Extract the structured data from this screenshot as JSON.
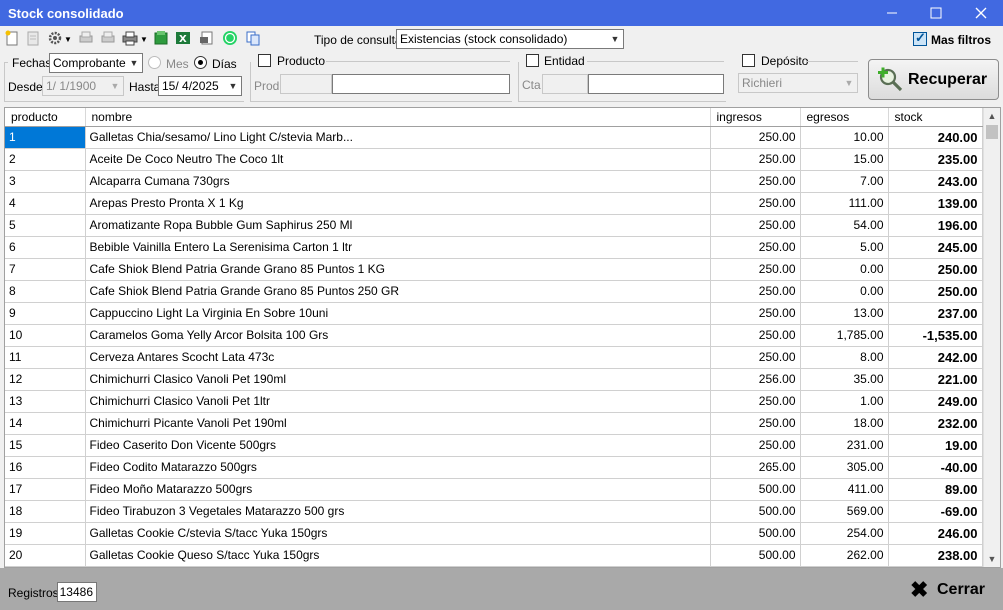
{
  "window": {
    "title": "Stock consolidado"
  },
  "toolbar": {
    "tipo_label": "Tipo de consulta",
    "tipo_value": "Existencias (stock consolidado)",
    "mas_filtros_label": "Mas filtros"
  },
  "filters": {
    "fechas_label": "Fechas",
    "fechas_value": "Comprobante",
    "mes_label": "Mes",
    "dias_label": "Días",
    "desde_label": "Desde",
    "desde_value": " 1/  1/1900",
    "hasta_label": "Hasta",
    "hasta_value": "15/  4/2025",
    "producto_label": "Producto",
    "prod_label": "Prod.",
    "entidad_label": "Entidad",
    "cta_label": "Cta",
    "deposito_label": "Depósito",
    "deposito_value": "Richieri",
    "recuperar_label": "Recuperar"
  },
  "grid": {
    "columns": [
      "producto",
      "nombre",
      "ingresos",
      "egresos",
      "stock"
    ],
    "rows": [
      [
        "1",
        "Galletas Chia/sesamo/ Lino Light C/stevia Marb...",
        "250.00",
        "10.00",
        "240.00"
      ],
      [
        "2",
        "Aceite De Coco Neutro The Coco 1lt",
        "250.00",
        "15.00",
        "235.00"
      ],
      [
        "3",
        "Alcaparra Cumana 730grs",
        "250.00",
        "7.00",
        "243.00"
      ],
      [
        "4",
        "Arepas Presto Pronta X 1 Kg",
        "250.00",
        "111.00",
        "139.00"
      ],
      [
        "5",
        "Aromatizante Ropa Bubble Gum Saphirus 250 Ml",
        "250.00",
        "54.00",
        "196.00"
      ],
      [
        "6",
        "Bebible Vainilla Entero La Serenisima Carton 1 ltr",
        "250.00",
        "5.00",
        "245.00"
      ],
      [
        "7",
        "Cafe Shiok Blend Patria Grande Grano 85 Puntos 1 KG",
        "250.00",
        "0.00",
        "250.00"
      ],
      [
        "8",
        "Cafe Shiok Blend Patria Grande Grano 85 Puntos 250 GR",
        "250.00",
        "0.00",
        "250.00"
      ],
      [
        "9",
        "Cappuccino Light La Virginia En Sobre 10uni",
        "250.00",
        "13.00",
        "237.00"
      ],
      [
        "10",
        "Caramelos Goma Yelly Arcor Bolsita 100 Grs",
        "250.00",
        "1,785.00",
        "-1,535.00"
      ],
      [
        "11",
        "Cerveza Antares Scocht Lata 473c",
        "250.00",
        "8.00",
        "242.00"
      ],
      [
        "12",
        "Chimichurri Clasico Vanoli Pet 190ml",
        "256.00",
        "35.00",
        "221.00"
      ],
      [
        "13",
        "Chimichurri Clasico Vanoli Pet 1ltr",
        "250.00",
        "1.00",
        "249.00"
      ],
      [
        "14",
        "Chimichurri Picante Vanoli Pet 190ml",
        "250.00",
        "18.00",
        "232.00"
      ],
      [
        "15",
        "Fideo Caserito Don Vicente 500grs",
        "250.00",
        "231.00",
        "19.00"
      ],
      [
        "16",
        "Fideo Codito Matarazzo 500grs",
        "265.00",
        "305.00",
        "-40.00"
      ],
      [
        "17",
        "Fideo Moño Matarazzo 500grs",
        "500.00",
        "411.00",
        "89.00"
      ],
      [
        "18",
        "Fideo Tirabuzon 3 Vegetales Matarazzo 500 grs",
        "500.00",
        "569.00",
        "-69.00"
      ],
      [
        "19",
        "Galletas Cookie C/stevia S/tacc Yuka 150grs",
        "500.00",
        "254.00",
        "246.00"
      ],
      [
        "20",
        "Galletas Cookie Queso S/tacc Yuka 150grs",
        "500.00",
        "262.00",
        "238.00"
      ]
    ]
  },
  "status": {
    "registros_label": "Registros",
    "registros_value": "13486",
    "cerrar_label": "Cerrar"
  },
  "colors": {
    "title_bar": "#4169e1",
    "selection": "#0078d7",
    "status_bar": "#a9a9a9"
  }
}
